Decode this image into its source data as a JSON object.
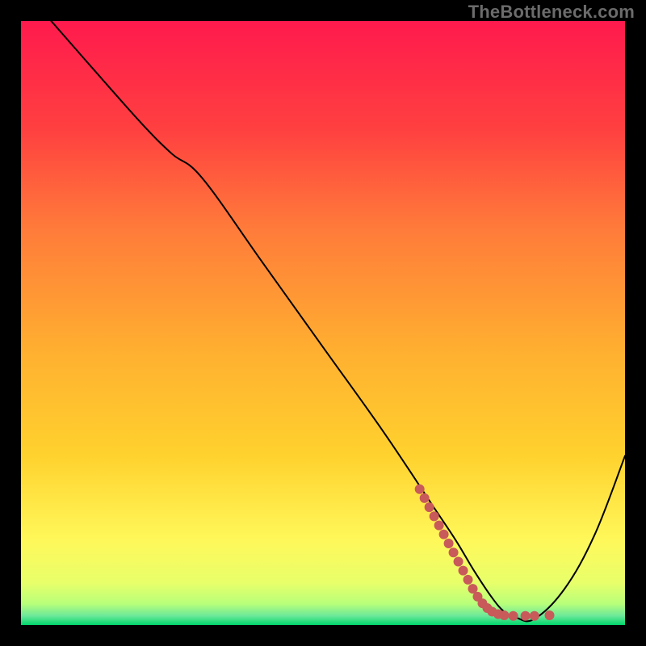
{
  "watermark": "TheBottleneck.com",
  "chart_data": {
    "type": "line",
    "title": "",
    "xlabel": "",
    "ylabel": "",
    "xlim": [
      0,
      100
    ],
    "ylim": [
      0,
      100
    ],
    "grid": false,
    "legend": false,
    "background_gradient": {
      "top_color": "#ff1a4d",
      "upper_mid_color": "#ff7a3a",
      "mid_color": "#ffd22e",
      "lower_color": "#fff85a",
      "near_bottom_color": "#e8ff6a",
      "bottom_color": "#00d66b"
    },
    "series": [
      {
        "name": "bottleneck-curve",
        "color": "#000000",
        "stroke_width": 2,
        "x": [
          5,
          12,
          20,
          25,
          30,
          40,
          50,
          60,
          68,
          72,
          75,
          78,
          80,
          82,
          85,
          90,
          95,
          100
        ],
        "y": [
          100,
          92,
          83,
          78,
          74,
          60,
          46,
          32,
          20,
          14,
          9,
          4.5,
          2.2,
          1.2,
          1.0,
          6,
          15,
          28
        ]
      }
    ],
    "scatter": {
      "name": "highlight-dots",
      "color": "#c85a5a",
      "radius": 6,
      "points": [
        {
          "x": 66.0,
          "y": 22.5
        },
        {
          "x": 66.8,
          "y": 21.0
        },
        {
          "x": 67.6,
          "y": 19.5
        },
        {
          "x": 68.4,
          "y": 18.0
        },
        {
          "x": 69.2,
          "y": 16.5
        },
        {
          "x": 70.0,
          "y": 15.0
        },
        {
          "x": 70.8,
          "y": 13.5
        },
        {
          "x": 71.6,
          "y": 12.0
        },
        {
          "x": 72.4,
          "y": 10.5
        },
        {
          "x": 73.2,
          "y": 9.0
        },
        {
          "x": 74.0,
          "y": 7.5
        },
        {
          "x": 74.8,
          "y": 6.0
        },
        {
          "x": 75.6,
          "y": 4.7
        },
        {
          "x": 76.4,
          "y": 3.6
        },
        {
          "x": 77.2,
          "y": 2.8
        },
        {
          "x": 78.0,
          "y": 2.2
        },
        {
          "x": 79.0,
          "y": 1.8
        },
        {
          "x": 80.0,
          "y": 1.6
        },
        {
          "x": 81.5,
          "y": 1.5
        },
        {
          "x": 83.5,
          "y": 1.5
        },
        {
          "x": 85.0,
          "y": 1.5
        },
        {
          "x": 87.5,
          "y": 1.6
        }
      ]
    }
  }
}
